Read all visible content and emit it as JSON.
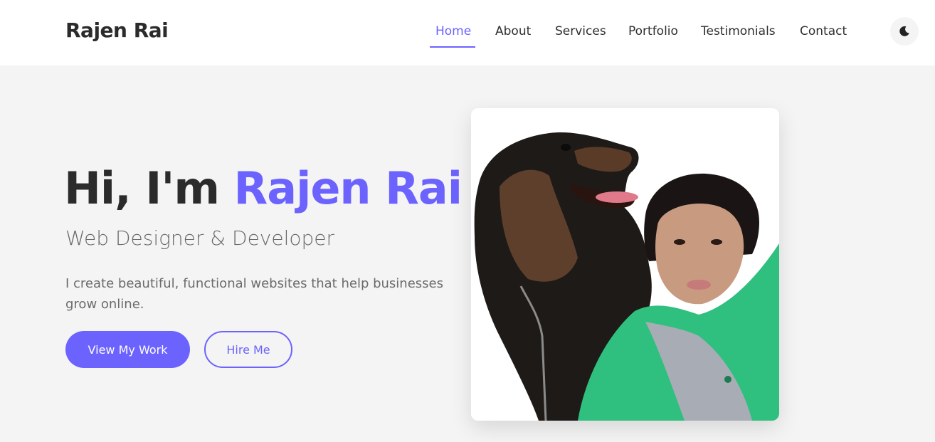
{
  "header": {
    "logo": "Rajen Rai",
    "nav": [
      {
        "label": "Home",
        "active": true
      },
      {
        "label": "About",
        "active": false
      },
      {
        "label": "Services",
        "active": false
      },
      {
        "label": "Portfolio",
        "active": false
      },
      {
        "label": "Testimonials",
        "active": false
      },
      {
        "label": "Contact",
        "active": false
      }
    ],
    "theme_toggle_icon": "moon-icon"
  },
  "hero": {
    "greeting": "Hi, I'm",
    "name": "Rajen Rai",
    "subtitle": "Web Designer & Developer",
    "description": "I create beautiful, functional websites that help businesses grow online.",
    "primary_button": "View My Work",
    "secondary_button": "Hire Me",
    "photo": "portrait-with-dog"
  },
  "colors": {
    "accent": "#6c63ff",
    "heading": "#2b2b2b",
    "muted": "#6b6b6b",
    "background": "#f4f4f4"
  }
}
